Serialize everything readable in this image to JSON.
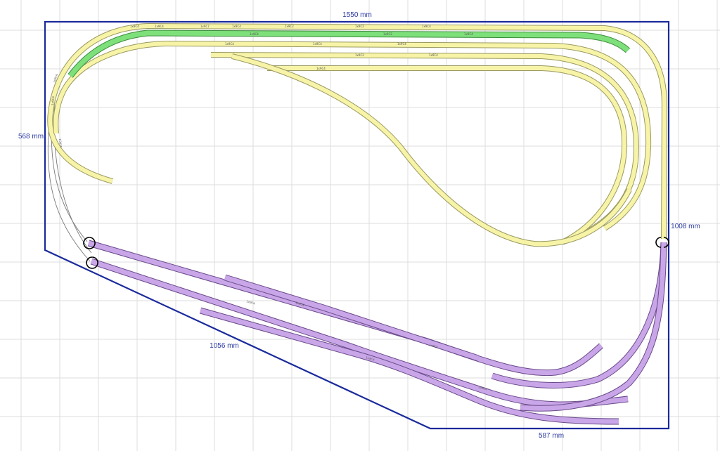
{
  "diagram": {
    "colors": {
      "background": "#ffffff",
      "grid": "#dcdcdc",
      "board_outline": "#1a2a9c",
      "dimension_text": "#2b3aa0",
      "track_yellow_fill": "#f7f4a8",
      "track_yellow_edge": "#9a9a62",
      "track_green_fill": "#7ee07a",
      "track_green_edge": "#3c8c3c",
      "track_purple_fill": "#c9a6e8",
      "track_purple_edge": "#6a4a8a",
      "connector_line": "#7a7a7a"
    },
    "dimensions": {
      "top": "1550 mm",
      "left": "568 mm",
      "right": "1008 mm",
      "diagonal": "1056 mm",
      "bottom": "587 mm"
    },
    "track_labels": {
      "upper_yard": [
        "1x9C4",
        "1x9C4",
        "1x9C7",
        "1x9C4",
        "1x9C2",
        "1x9C2",
        "1x9C4",
        "1x9C4",
        "1x9C2",
        "1x9C4"
      ],
      "lower_yard": [
        "1x9C4",
        "1x9C4",
        "1x9C2",
        "1x9C4",
        "1x9C4",
        "1x9C4"
      ],
      "left_curve": [
        "1x9C4",
        "1x9C4",
        "1x9C4"
      ],
      "purple_yard": [
        "1x9C4",
        "1x9C4",
        "1x9C4",
        "1x9C4",
        "1x9C4"
      ]
    }
  }
}
